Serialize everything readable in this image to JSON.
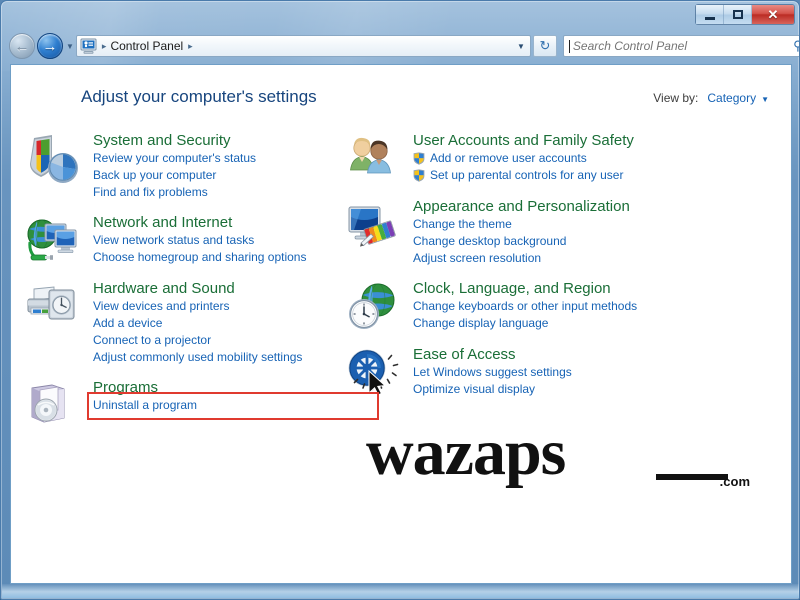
{
  "window": {
    "titlebar": {
      "minimize_label": "–",
      "maximize_label": "□",
      "close_label": "✕"
    },
    "nav": {
      "back_glyph": "←",
      "forward_glyph": "→",
      "recent_glyph": "▼"
    },
    "address": {
      "icon_name": "control-panel-icon",
      "crumb": "Control Panel",
      "separator": "▸",
      "dropdown_glyph": "▼",
      "refresh_glyph": "↻"
    },
    "search": {
      "placeholder": "Search Control Panel",
      "value": "",
      "icon_glyph": "⚲"
    }
  },
  "content": {
    "page_title": "Adjust your computer's settings",
    "view_by": {
      "label": "View by:",
      "value": "Category",
      "caret": "▼"
    },
    "left_column": [
      {
        "icon": "security-shield-icon",
        "title": "System and Security",
        "links": [
          {
            "text": "Review your computer's status",
            "shield": false
          },
          {
            "text": "Back up your computer",
            "shield": false
          },
          {
            "text": "Find and fix problems",
            "shield": false
          }
        ]
      },
      {
        "icon": "network-globe-icon",
        "title": "Network and Internet",
        "links": [
          {
            "text": "View network status and tasks",
            "shield": false
          },
          {
            "text": "Choose homegroup and sharing options",
            "shield": false
          }
        ]
      },
      {
        "icon": "printer-hardware-icon",
        "title": "Hardware and Sound",
        "links": [
          {
            "text": "View devices and printers",
            "shield": false
          },
          {
            "text": "Add a device",
            "shield": false
          },
          {
            "text": "Connect to a projector",
            "shield": false
          },
          {
            "text": "Adjust commonly used mobility settings",
            "shield": false
          }
        ]
      },
      {
        "icon": "programs-disc-icon",
        "title": "Programs",
        "links": [
          {
            "text": "Uninstall a program",
            "shield": false,
            "highlighted": true
          }
        ]
      }
    ],
    "right_column": [
      {
        "icon": "user-accounts-icon",
        "title": "User Accounts and Family Safety",
        "links": [
          {
            "text": "Add or remove user accounts",
            "shield": true
          },
          {
            "text": "Set up parental controls for any user",
            "shield": true
          }
        ]
      },
      {
        "icon": "appearance-monitor-icon",
        "title": "Appearance and Personalization",
        "links": [
          {
            "text": "Change the theme",
            "shield": false
          },
          {
            "text": "Change desktop background",
            "shield": false
          },
          {
            "text": "Adjust screen resolution",
            "shield": false
          }
        ]
      },
      {
        "icon": "clock-globe-icon",
        "title": "Clock, Language, and Region",
        "links": [
          {
            "text": "Change keyboards or other input methods",
            "shield": false
          },
          {
            "text": "Change display language",
            "shield": false
          }
        ]
      },
      {
        "icon": "ease-of-access-icon",
        "title": "Ease of Access",
        "links": [
          {
            "text": "Let Windows suggest settings",
            "shield": false
          },
          {
            "text": "Optimize visual display",
            "shield": false
          }
        ]
      }
    ]
  },
  "watermark": {
    "text": "wazaps",
    "suffix": ".com"
  },
  "colors": {
    "category_title": "#1a6e37",
    "link": "#1763b5",
    "page_title": "#17457e",
    "highlight": "#e03a2f",
    "close_button": "#bb2c24"
  }
}
